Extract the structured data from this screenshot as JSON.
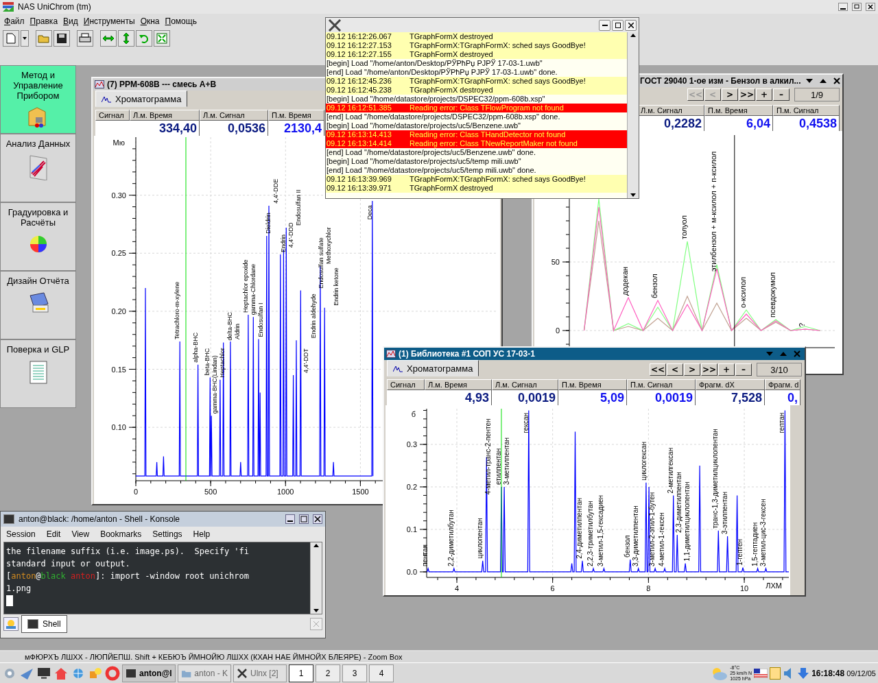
{
  "app": {
    "title": "NAS UniChrom (tm)",
    "menu": [
      "Файл",
      "Правка",
      "Вид",
      "Инструменты",
      "Окна",
      "Помощь"
    ]
  },
  "sidebar": {
    "items": [
      {
        "label": "Метод и Управление Прибором",
        "selected": true
      },
      {
        "label": "Анализ Данных",
        "selected": false
      },
      {
        "label": "Градуировка и Расчёты",
        "selected": false
      },
      {
        "label": "Дизайн Отчёта",
        "selected": false
      },
      {
        "label": "Поверка и GLP",
        "selected": false
      }
    ]
  },
  "windows": [
    {
      "title": "(7) PPM-608B --- смесь А+В",
      "active": false,
      "tabs": [
        {
          "label": "Хроматограмма",
          "selected": true
        }
      ],
      "columns": [
        {
          "label": "Сигнал"
        },
        {
          "label": "Л.м. Время",
          "value": "334,40",
          "kind": "left"
        },
        {
          "label": "Л.м. Сигнал",
          "value": "0,0536",
          "kind": "left"
        },
        {
          "label": "П.м. Время",
          "value": "2130,4",
          "kind": "right"
        }
      ],
      "chart_data": {
        "type": "line",
        "grid": true,
        "ylabel": "Мю",
        "xlim": [
          0,
          2410
        ],
        "ylim": [
          0.054,
          0.35
        ],
        "xticks": [
          0,
          500,
          1000,
          1500
        ],
        "yticks": [
          {
            "value": 0.1,
            "label": "0.10"
          },
          {
            "value": 0.15,
            "label": "0.15"
          },
          {
            "value": 0.2,
            "label": "0.20"
          },
          {
            "value": 0.25,
            "label": "0.25"
          },
          {
            "value": 0.3,
            "label": "0.30"
          }
        ],
        "ref_lines": [
          {
            "axis": "x",
            "value": 334.4,
            "color": "#00e000"
          }
        ],
        "x": [
          0,
          60,
          64,
          68,
          136,
          140,
          144,
          181,
          185,
          189,
          290,
          294,
          298,
          411,
          415,
          419,
          492,
          496,
          500,
          501,
          505,
          509,
          559,
          563,
          567,
          581,
          585,
          589,
          628,
          632,
          636,
          696,
          700,
          704,
          747,
          751,
          755,
          781,
          785,
          789,
          816,
          820,
          824,
          826,
          830,
          834,
          870,
          874,
          878,
          885,
          889,
          893,
          962,
          966,
          970,
          983,
          987,
          991,
          1001,
          1005,
          1009,
          1048,
          1052,
          1056,
          1068,
          1072,
          1076,
          1097,
          1101,
          1105,
          1228,
          1232,
          1236,
          1257,
          1261,
          1265,
          1316,
          1320,
          1324,
          1576,
          1580,
          1584
        ],
        "series": [
          {
            "color": "#0000ff",
            "values": [
              0.058,
              0.058,
              0.22,
              0.058,
              0.058,
              0.07,
              0.058,
              0.058,
              0.075,
              0.058,
              0.058,
              0.174,
              0.058,
              0.058,
              0.154,
              0.058,
              0.058,
              0.143,
              0.058,
              0.058,
              0.11,
              0.058,
              0.058,
              0.141,
              0.058,
              0.058,
              0.173,
              0.058,
              0.058,
              0.174,
              0.058,
              0.058,
              0.07,
              0.058,
              0.058,
              0.197,
              0.058,
              0.058,
              0.195,
              0.058,
              0.058,
              0.176,
              0.058,
              0.058,
              0.13,
              0.058,
              0.058,
              0.265,
              0.058,
              0.058,
              0.291,
              0.058,
              0.058,
              0.249,
              0.058,
              0.058,
              0.253,
              0.058,
              0.058,
              0.272,
              0.058,
              0.058,
              0.145,
              0.058,
              0.058,
              0.175,
              0.058,
              0.058,
              0.218,
              0.058,
              0.058,
              0.239,
              0.058,
              0.058,
              0.203,
              0.058,
              0.058,
              0.07,
              0.058,
              0.058,
              0.295,
              0.058
            ]
          }
        ],
        "annotations": [
          {
            "x": 294,
            "y": 0.174,
            "text": "Tetrachloro-m-xylene"
          },
          {
            "x": 415,
            "y": 0.154,
            "text": "alpha-BHC"
          },
          {
            "x": 496,
            "y": 0.143,
            "text": "beta-BHC"
          },
          {
            "x": 505,
            "y": 0.11,
            "text": "gamma-BHC(Lindan)"
          },
          {
            "x": 563,
            "y": 0.141,
            "text": "Heptachlor"
          },
          {
            "x": 585,
            "y": 0.173,
            "text": "delta-BHC"
          },
          {
            "x": 632,
            "y": 0.174,
            "text": "Aldrin"
          },
          {
            "x": 751,
            "y": 0.197,
            "text": "Heptachlor epoxide"
          },
          {
            "x": 785,
            "y": 0.195,
            "text": "gamma-Chlordane"
          },
          {
            "x": 820,
            "y": 0.176,
            "text": "Endosulfan I"
          },
          {
            "x": 874,
            "y": 0.265,
            "text": "Dieldrin"
          },
          {
            "x": 889,
            "y": 0.291,
            "text": "4,4'-DDE"
          },
          {
            "x": 966,
            "y": 0.249,
            "text": "Endrin"
          },
          {
            "x": 987,
            "y": 0.253,
            "text": "4,4'-DDD"
          },
          {
            "x": 1005,
            "y": 0.272,
            "text": "Endosulfan II"
          },
          {
            "x": 1052,
            "y": 0.145,
            "text": "4,4'-DDT"
          },
          {
            "x": 1072,
            "y": 0.175,
            "text": "Endrin aldehyde"
          },
          {
            "x": 1101,
            "y": 0.218,
            "text": "Endosulfan sulfate"
          },
          {
            "x": 1232,
            "y": 0.239,
            "text": "Methoxychlor"
          },
          {
            "x": 1261,
            "y": 0.203,
            "text": "Endrin ketone"
          },
          {
            "x": 1580,
            "y": 0.295,
            "text": "Deca"
          }
        ]
      }
    },
    {
      "title": "ГОСТ 29040 1-ое изм - Бензол в алкил...",
      "active": false,
      "nav": [
        {
          "label": "<<",
          "disabled": true
        },
        {
          "label": "<",
          "disabled": true
        },
        {
          "label": ">",
          "disabled": false
        },
        {
          "label": ">>",
          "disabled": false
        },
        {
          "label": "+",
          "disabled": false
        },
        {
          "label": "–",
          "disabled": false
        }
      ],
      "page": "1/9",
      "columns": [
        {
          "label": "Л.м. Сигнал",
          "value": "0,2282",
          "kind": "left"
        },
        {
          "label": "П.м. Время",
          "value": "6,04",
          "kind": "right"
        },
        {
          "label": "П.м. Сигнал",
          "value": "0,4538",
          "kind": "right"
        }
      ],
      "chart_data": {
        "type": "line",
        "grid": true,
        "ylim": [
          -12.5,
          142.5
        ],
        "yticks": [
          0,
          50
        ],
        "categories": [
          null,
          null,
          null,
          null,
          null,
          null,
          null,
          null,
          null,
          null,
          null,
          null,
          null,
          null,
          null,
          null,
          null
        ],
        "series": [
          {
            "color": "#c0a090",
            "values": [
              0,
              80,
              0,
              3,
              0,
              9,
              0,
              25,
              0,
              20,
              0,
              9,
              0,
              6,
              0,
              1,
              0
            ]
          },
          {
            "color": "#80ff80",
            "values": [
              0,
              96,
              0,
              5,
              0,
              17,
              0,
              65,
              0,
              48,
              0,
              15,
              0,
              8,
              0,
              3,
              0
            ]
          },
          {
            "color": "#ff60c0",
            "values": [
              0,
              90,
              0,
              24,
              0,
              22,
              0,
              19,
              0,
              45,
              0,
              12,
              0,
              7,
              0,
              1,
              0
            ]
          }
        ],
        "annotations": [
          {
            "y": 24,
            "text": "додекан"
          },
          {
            "y": 22,
            "text": "бензол"
          },
          {
            "y": 65,
            "text": "толуол"
          },
          {
            "y": 48,
            "text": "этилбензол + м-ксилол + п-ксилол"
          },
          {
            "y": 15,
            "text": "о-ксилол"
          },
          {
            "y": 8,
            "text": "псевдокумол"
          },
          {
            "y": 1,
            "text": "?"
          }
        ]
      }
    },
    {
      "title": "(1) Библиотека #1 СОП УС 17-03-1",
      "active": true,
      "tabs": [
        {
          "label": "Хроматограмма",
          "selected": true
        }
      ],
      "nav": [
        {
          "label": "<<",
          "disabled": false
        },
        {
          "label": "<",
          "disabled": false
        },
        {
          "label": ">",
          "disabled": false
        },
        {
          "label": ">>",
          "disabled": false
        },
        {
          "label": "+",
          "disabled": false
        },
        {
          "label": "–",
          "disabled": false
        }
      ],
      "page": "3/10",
      "columns": [
        {
          "label": "Сигнал"
        },
        {
          "label": "Л.м. Время",
          "value": "4,93",
          "kind": "left"
        },
        {
          "label": "Л.м. Сигнал",
          "value": "0,0019",
          "kind": "left"
        },
        {
          "label": "П.м. Время",
          "value": "5,09",
          "kind": "right"
        },
        {
          "label": "П.м. Сигнал",
          "value": "0,0019",
          "kind": "right"
        },
        {
          "label": "Фрагм. dX",
          "value": "7,528",
          "kind": "left"
        },
        {
          "label": "Фрагм. d",
          "value": "0,",
          "kind": "right"
        }
      ],
      "chart_data": {
        "type": "line",
        "grid": true,
        "xlabel": "ЛХМ",
        "ylabel": "б",
        "xlim": [
          3.37,
          10.93
        ],
        "ylim": [
          -0.013,
          0.384
        ],
        "xticks": [
          4,
          6,
          8,
          10
        ],
        "yticks": [
          {
            "value": 0,
            "label": "0.0"
          },
          0.1,
          0.2,
          0.3
        ],
        "ref_lines": [
          {
            "axis": "x",
            "value": 4.93,
            "color": "#00e000"
          }
        ],
        "x": [
          3.37,
          3.38,
          3.4,
          3.42,
          3.92,
          3.94,
          3.96,
          4.52,
          4.54,
          4.56,
          4.6,
          4.62,
          4.64,
          4.91,
          4.93,
          4.95,
          4.97,
          4.99,
          5.01,
          5.48,
          5.5,
          5.52,
          6.38,
          6.4,
          6.42,
          6.45,
          6.47,
          6.49,
          6.6,
          6.62,
          6.64,
          6.83,
          6.85,
          6.87,
          7.05,
          7.07,
          7.09,
          7.6,
          7.62,
          7.64,
          7.77,
          7.79,
          7.81,
          7.93,
          7.95,
          7.97,
          7.99,
          8.01,
          8.03,
          8.12,
          8.14,
          8.16,
          8.32,
          8.34,
          8.36,
          8.5,
          8.52,
          8.54,
          8.58,
          8.6,
          8.62,
          8.75,
          8.77,
          8.79,
          9.05,
          9.07,
          9.09,
          9.44,
          9.46,
          9.48,
          9.63,
          9.65,
          9.67,
          9.83,
          9.85,
          9.87,
          9.95,
          9.97,
          9.99,
          10.26,
          10.28,
          10.3,
          10.43,
          10.45,
          10.47,
          10.83,
          10.85,
          10.87,
          10.93
        ],
        "series": [
          {
            "color": "#0000ff",
            "values": [
              0,
              0,
              0.008,
              0,
              0,
              0.008,
              0,
              0,
              0.026,
              0,
              0,
              0.27,
              0,
              0,
              0.2,
              0,
              0,
              0.2,
              0,
              0,
              0.38,
              0,
              0,
              0.02,
              0,
              0,
              0.33,
              0,
              0,
              0.026,
              0,
              0,
              0.008,
              0,
              0,
              0.008,
              0,
              0,
              0.029,
              0,
              0,
              0.008,
              0,
              0,
              0.21,
              0,
              0,
              0.2,
              0,
              0,
              0.008,
              0,
              0,
              0.008,
              0,
              0,
              0.18,
              0,
              0,
              0.087,
              0,
              0,
              0.02,
              0,
              0,
              0.25,
              0,
              0,
              0.097,
              0,
              0,
              0.084,
              0,
              0,
              0.18,
              0,
              0,
              0.01,
              0,
              0,
              0.008,
              0,
              0,
              0.008,
              0,
              0,
              0.38,
              0,
              0
            ]
          }
        ],
        "annotations": [
          {
            "x": 3.4,
            "y": 0.008,
            "text": "пентан"
          },
          {
            "x": 3.94,
            "y": 0.008,
            "text": "2,2-диметилбутан"
          },
          {
            "x": 4.54,
            "y": 0.026,
            "text": "циклопентан"
          },
          {
            "x": 4.62,
            "y": 0.27,
            "text": "4-метил-транс-2-пентен"
          },
          {
            "x": 4.93,
            "y": 0.2,
            "text": "етилпентан"
          },
          {
            "x": 4.99,
            "y": 0.2,
            "text": "3-метилпентан"
          },
          {
            "x": 5.5,
            "y": 0.38,
            "text": "гексан"
          },
          {
            "x": 6.62,
            "y": 0.026,
            "text": "2,4-диметилпентан"
          },
          {
            "x": 6.85,
            "y": 0.008,
            "text": "2,2,3-триметилбутан"
          },
          {
            "x": 7.07,
            "y": 0.008,
            "text": "3-метил-1,5-гексадиен"
          },
          {
            "x": 7.62,
            "y": 0.029,
            "text": "бензол"
          },
          {
            "x": 7.79,
            "y": 0.008,
            "text": "3,3-диметилпентан"
          },
          {
            "x": 7.95,
            "y": 0.21,
            "text": "циклогексан"
          },
          {
            "x": 8.14,
            "y": 0.008,
            "text": "3-метил-2-этил-1-бутен"
          },
          {
            "x": 8.34,
            "y": 0.008,
            "text": "4-метил-1-гексен"
          },
          {
            "x": 8.52,
            "y": 0.18,
            "text": "2-метилгексан"
          },
          {
            "x": 8.6,
            "y": 0.087,
            "text": "2,3-диметилпентан"
          },
          {
            "x": 8.77,
            "y": 0.02,
            "text": "1,1-диметилциклопентан"
          },
          {
            "x": 9.46,
            "y": 0.097,
            "text": "транс-1,3-диметилциклопентан"
          },
          {
            "x": 9.65,
            "y": 0.084,
            "text": "3-этилпентан"
          },
          {
            "x": 9.97,
            "y": 0.01,
            "text": "1-гептен"
          },
          {
            "x": 10.28,
            "y": 0.008,
            "text": "1,5-гептадиен"
          },
          {
            "x": 10.45,
            "y": 0.008,
            "text": "3-метил-цис-3-гексен"
          },
          {
            "x": 10.85,
            "y": 0.38,
            "text": "гептан"
          }
        ]
      }
    }
  ],
  "log": {
    "entries": [
      {
        "kind": "event",
        "time": "09.12 16:12:26.067",
        "text": "TGraphFormX destroyed"
      },
      {
        "kind": "event",
        "time": "09.12 16:12:27.153",
        "text": "TGraphFormX:TGraphFormX: sched says GoodBye!"
      },
      {
        "kind": "event",
        "time": "09.12 16:12:27.155",
        "text": "TGraphFormX destroyed"
      },
      {
        "kind": "load",
        "text": "[begin] Load \"/home/anton/Desktop/РЎРћРџ РЈРЎ 17-03-1.uwb\""
      },
      {
        "kind": "load",
        "text": "[end] Load \"/home/anton/Desktop/РЎРћРџ РЈРЎ 17-03-1.uwb\" done."
      },
      {
        "kind": "event",
        "time": "09.12 16:12:45.236",
        "text": "TGraphFormX:TGraphFormX: sched says GoodBye!"
      },
      {
        "kind": "event",
        "time": "09.12 16:12:45.238",
        "text": "TGraphFormX destroyed"
      },
      {
        "kind": "load",
        "text": "[begin] Load \"/home/datastore/projects/DSPEC32/ppm-608b.xsp\""
      },
      {
        "kind": "error",
        "time": "09.12 16:12:51.385",
        "text": "Reading error: Class TFlowProgram not found"
      },
      {
        "kind": "load",
        "text": "[end] Load \"/home/datastore/projects/DSPEC32/ppm-608b.xsp\" done."
      },
      {
        "kind": "load",
        "text": "[begin] Load \"/home/datastore/projects/uc5/Benzene.uwb\""
      },
      {
        "kind": "error",
        "time": "09.12 16:13:14.413",
        "text": "Reading error: Class THandDetector not found"
      },
      {
        "kind": "error",
        "time": "09.12 16:13:14.414",
        "text": "Reading error: Class TNewReportMaker not found"
      },
      {
        "kind": "load",
        "text": "[end] Load \"/home/datastore/projects/uc5/Benzene.uwb\" done."
      },
      {
        "kind": "load",
        "text": "[begin] Load \"/home/datastore/projects/uc5/temp mili.uwb\""
      },
      {
        "kind": "load",
        "text": "[end] Load \"/home/datastore/projects/uc5/temp mili.uwb\" done."
      },
      {
        "kind": "event",
        "time": "09.12 16:13:39.969",
        "text": "TGraphFormX:TGraphFormX: sched says GoodBye!"
      },
      {
        "kind": "event",
        "time": "09.12 16:13:39.971",
        "text": "TGraphFormX destroyed"
      }
    ]
  },
  "konsole": {
    "title": "anton@black: /home/anton - Shell - Konsole",
    "menu": [
      "Session",
      "Edit",
      "View",
      "Bookmarks",
      "Settings",
      "Help"
    ],
    "lines": [
      {
        "segments": [
          {
            "text": "the filename suffix (i.e. image.ps).  Specify 'fi"
          }
        ]
      },
      {
        "segments": [
          {
            "text": "standard input or output."
          }
        ]
      },
      {
        "segments": [
          {
            "text": "["
          },
          {
            "text": "anton",
            "color": "#d08a20"
          },
          {
            "text": "@"
          },
          {
            "text": "black",
            "color": "#30b030"
          },
          {
            "text": "anton",
            "color": "#d02020",
            "space_before": true
          },
          {
            "text": "]: import -window root unichrom"
          }
        ]
      },
      {
        "segments": [
          {
            "text": "1.png"
          }
        ]
      }
    ],
    "tabs": [
      {
        "label": "Shell",
        "selected": true
      }
    ]
  },
  "status_bar": {
    "text": "мФЮРХЪ ЛШХХ - ЛЮПЙЕПШ. Shift + КЕБЮЪ ЙМНОЙЮ ЛШХХ (КХАН НАЕ ЙМНОЙХ БЛЕЯРЕ) - Zoom Box"
  },
  "taskbar": {
    "tasks": [
      {
        "label": "anton@l",
        "selected": true
      },
      {
        "label": "anton - K",
        "selected": false
      },
      {
        "label": "Ulnx [2]",
        "selected": false
      }
    ],
    "desktops": [
      {
        "label": "1",
        "selected": true
      },
      {
        "label": "2",
        "selected": false
      },
      {
        "label": "3",
        "selected": false
      },
      {
        "label": "4",
        "selected": false
      }
    ],
    "weather": [
      "-8°C",
      "25 km/h N",
      "1025 hPa"
    ],
    "clock": "16:18:48",
    "date": "09/12/05"
  }
}
